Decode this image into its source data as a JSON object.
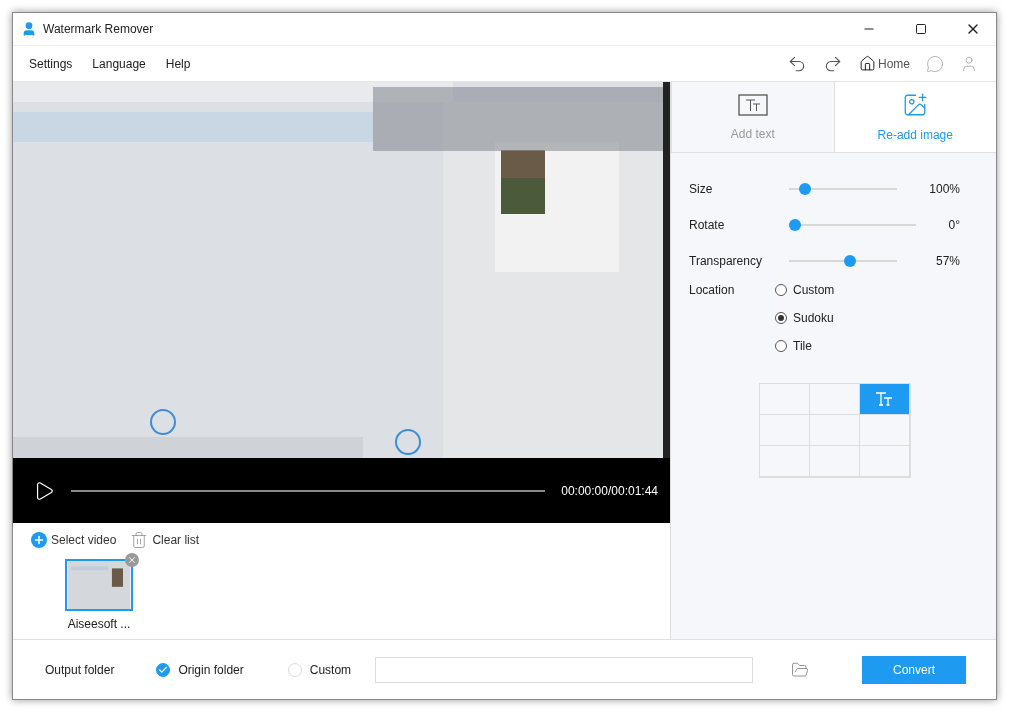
{
  "window": {
    "title": "Watermark Remover"
  },
  "menu": [
    "Settings",
    "Language",
    "Help"
  ],
  "toolbar": {
    "home": "Home"
  },
  "player": {
    "time": "00:00:00/00:01:44",
    "level": 0
  },
  "file_actions": {
    "select": "Select video",
    "clear": "Clear list"
  },
  "files": [
    {
      "name": "Aiseesoft ...",
      "selected": true
    }
  ],
  "tabs": [
    {
      "label": "Add text",
      "selected": false
    },
    {
      "label": "Re-add image",
      "selected": true
    }
  ],
  "settings": [
    {
      "label": "Size",
      "level": 0.1,
      "reading": "100%"
    },
    {
      "label": "Rotate",
      "level": 0,
      "reading": "0°"
    },
    {
      "label": "Transparency",
      "level": 0.57,
      "reading": "57%"
    }
  ],
  "location": {
    "label": "Location",
    "options": [
      {
        "label": "Custom",
        "selected": false
      },
      {
        "label": "Sudoku",
        "selected": true
      },
      {
        "label": "Tile",
        "selected": false
      }
    ],
    "grid": [
      {
        "selected": false
      },
      {
        "selected": false
      },
      {
        "selected": true
      },
      {
        "selected": false
      },
      {
        "selected": false
      },
      {
        "selected": false
      },
      {
        "selected": false
      },
      {
        "selected": false
      },
      {
        "selected": false
      }
    ]
  },
  "output": {
    "label": "Output folder",
    "options": [
      {
        "label": "Origin folder",
        "selected": true
      },
      {
        "label": "Custom",
        "selected": false
      }
    ],
    "convert": "Convert"
  }
}
